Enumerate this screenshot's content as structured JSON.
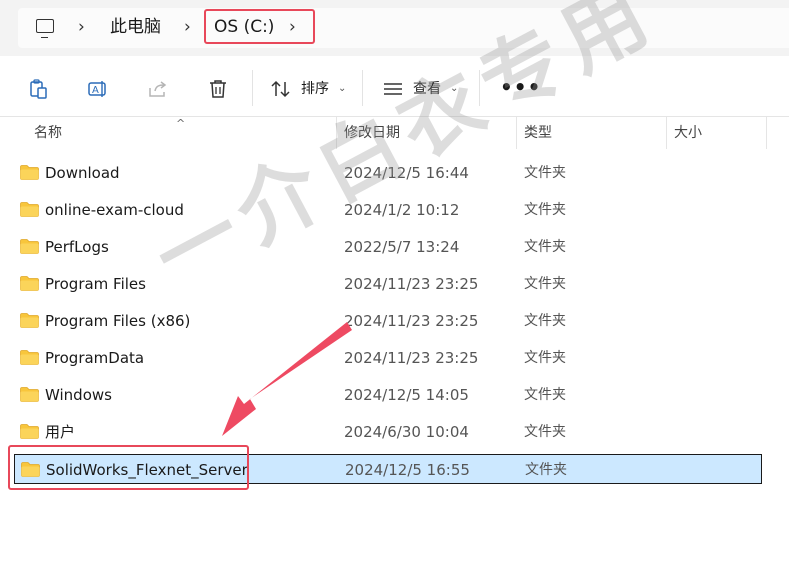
{
  "address_bar": {
    "crumbs": [
      "此电脑",
      "OS (C:)"
    ],
    "separator": "›",
    "icon": "computer-icon"
  },
  "toolbar": {
    "sort_label": "排序",
    "view_label": "查看",
    "more_label": "•••",
    "caret": "⌄",
    "icons": [
      "clipboard-icon",
      "rename-icon",
      "share-icon",
      "delete-icon",
      "sort-icon",
      "view-icon"
    ]
  },
  "columns": {
    "name": "名称",
    "modified": "修改日期",
    "type": "类型",
    "size": "大小",
    "sort_caret": "^"
  },
  "files": [
    {
      "name": "Download",
      "modified": "2024/12/5 16:44",
      "type": "文件夹"
    },
    {
      "name": "online-exam-cloud",
      "modified": "2024/1/2 10:12",
      "type": "文件夹"
    },
    {
      "name": "PerfLogs",
      "modified": "2022/5/7 13:24",
      "type": "文件夹"
    },
    {
      "name": "Program Files",
      "modified": "2024/11/23 23:25",
      "type": "文件夹"
    },
    {
      "name": "Program Files (x86)",
      "modified": "2024/11/23 23:25",
      "type": "文件夹"
    },
    {
      "name": "ProgramData",
      "modified": "2024/11/23 23:25",
      "type": "文件夹"
    },
    {
      "name": "Windows",
      "modified": "2024/12/5 14:05",
      "type": "文件夹"
    },
    {
      "name": "用户",
      "modified": "2024/6/30 10:04",
      "type": "文件夹"
    },
    {
      "name": "SolidWorks_Flexnet_Server",
      "modified": "2024/12/5 16:55",
      "type": "文件夹"
    }
  ],
  "selected_index": 8,
  "watermark": "一介白衣专用",
  "colors": {
    "highlight_red": "#e8485a",
    "selection_blue": "#cce8ff",
    "folder_yellow": "#f8c63c"
  }
}
